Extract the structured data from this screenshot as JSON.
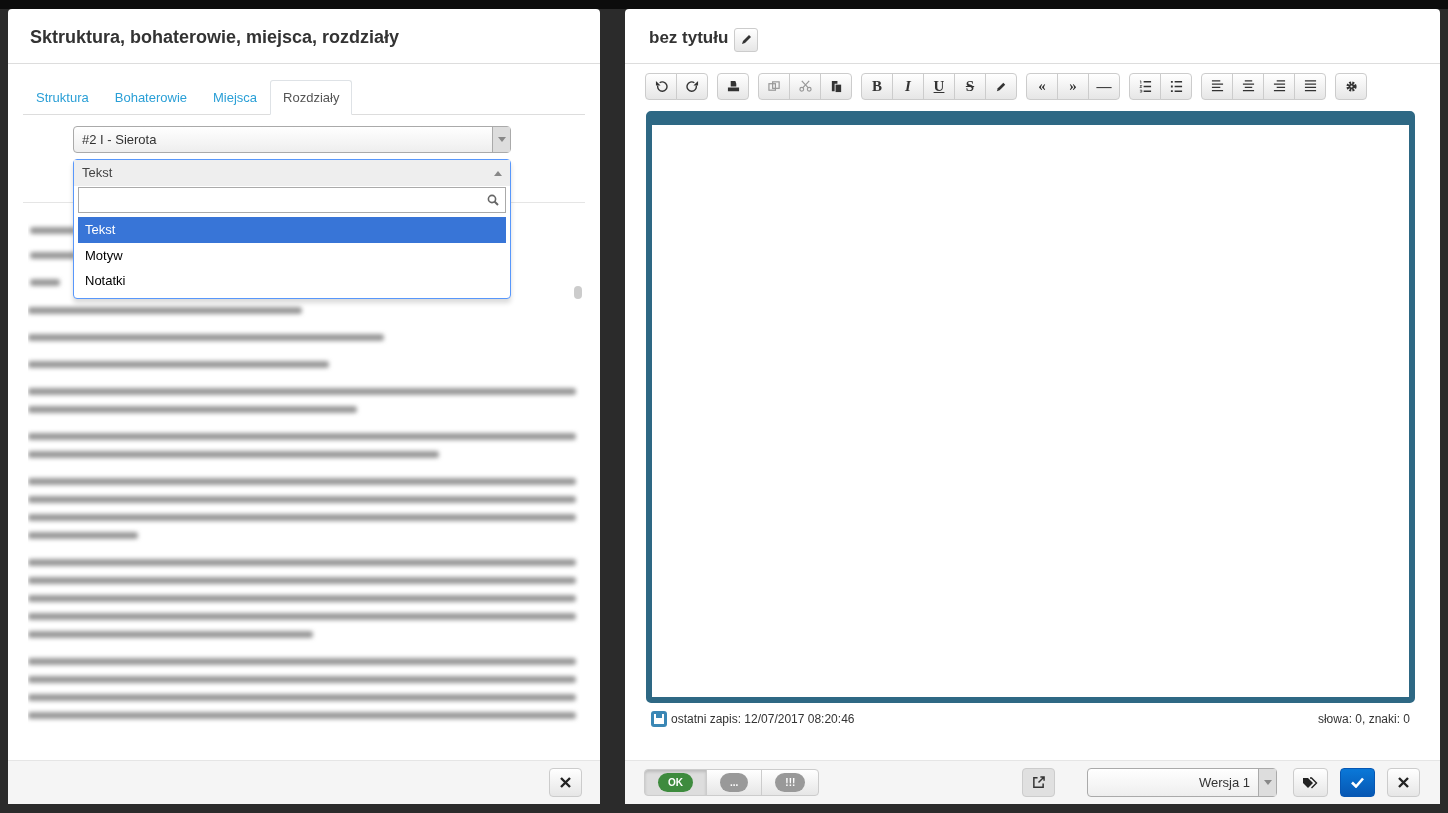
{
  "left_modal": {
    "title": "Sktruktura, bohaterowie, miejsca, rozdziały",
    "tabs": [
      {
        "label": "Struktura",
        "selected": false
      },
      {
        "label": "Bohaterowie",
        "selected": false
      },
      {
        "label": "Miejsca",
        "selected": false
      },
      {
        "label": "Rozdziały",
        "selected": true
      }
    ],
    "chapter_select": {
      "value": "#2 I - Sierota"
    },
    "type_select": {
      "value": "Tekst",
      "expanded": true,
      "options": [
        {
          "label": "Tekst",
          "selected": true
        },
        {
          "label": "Motyw",
          "selected": false
        },
        {
          "label": "Notatki",
          "selected": false
        }
      ]
    }
  },
  "right_modal": {
    "title": "bez tytułu",
    "toolbar": [
      [
        {
          "kind": "undo",
          "disabled": false
        },
        {
          "kind": "redo",
          "disabled": false
        }
      ],
      [
        {
          "kind": "print",
          "disabled": false
        }
      ],
      [
        {
          "kind": "copy",
          "disabled": true
        },
        {
          "kind": "cut",
          "disabled": true
        },
        {
          "kind": "paste",
          "disabled": false
        }
      ],
      [
        {
          "kind": "bold",
          "label": "B",
          "disabled": false
        },
        {
          "kind": "italic",
          "label": "I",
          "disabled": false
        },
        {
          "kind": "underline",
          "label": "U",
          "disabled": false
        },
        {
          "kind": "strikethrough",
          "label": "S",
          "disabled": false
        },
        {
          "kind": "pencil",
          "disabled": false
        }
      ],
      [
        {
          "kind": "quote-open",
          "label": "«",
          "disabled": false
        },
        {
          "kind": "quote-close",
          "label": "»",
          "disabled": false
        },
        {
          "kind": "dash",
          "label": "—",
          "disabled": false
        }
      ],
      [
        {
          "kind": "ordered-list",
          "disabled": false
        },
        {
          "kind": "bullet-list",
          "disabled": false
        }
      ],
      [
        {
          "kind": "align-left",
          "disabled": false
        },
        {
          "kind": "align-center",
          "disabled": false
        },
        {
          "kind": "align-right",
          "disabled": false
        },
        {
          "kind": "align-justify",
          "disabled": false
        }
      ],
      [
        {
          "kind": "settings",
          "disabled": false
        }
      ]
    ],
    "last_saved": "ostatni zapis: 12/07/2017 08:20:46",
    "counts": "słowa: 0, znaki: 0",
    "status_buttons": [
      {
        "label": "OK",
        "selected": true
      },
      {
        "label": "...",
        "selected": false
      },
      {
        "label": "!!!",
        "selected": false
      }
    ],
    "version_select": {
      "value": "Wersja 1"
    }
  }
}
